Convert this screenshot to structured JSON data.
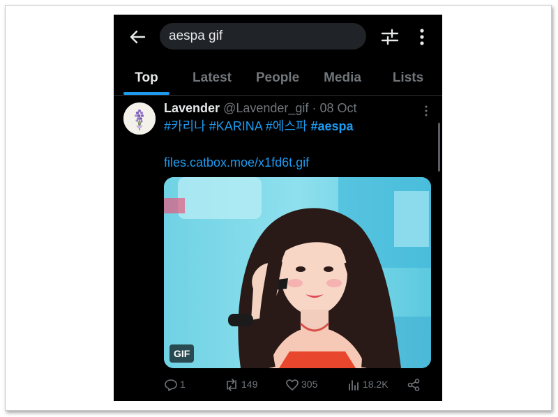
{
  "search": {
    "query": "aespa gif"
  },
  "icons": {
    "back": "arrow-left-icon",
    "filter": "sliders-icon",
    "more": "more-vertical-icon"
  },
  "tabs": [
    {
      "label": "Top",
      "active": true
    },
    {
      "label": "Latest",
      "active": false
    },
    {
      "label": "People",
      "active": false
    },
    {
      "label": "Media",
      "active": false
    },
    {
      "label": "Lists",
      "active": false
    }
  ],
  "tweet": {
    "name": "Lavender",
    "handle": "@Lavender_gif",
    "separator": "·",
    "date": "08 Oct",
    "hashtags": [
      "#카리나",
      "#KARINA",
      "#에스파",
      "#aespa"
    ],
    "link": "files.catbox.moe/x1fd6t.gif",
    "media_badge": "GIF",
    "actions": {
      "replies": "1",
      "retweets": "149",
      "likes": "305",
      "views": "18.2K"
    }
  },
  "colors": {
    "background": "#000000",
    "accent": "#1d9bf0",
    "muted": "#71767b",
    "text": "#e7e9ea"
  }
}
